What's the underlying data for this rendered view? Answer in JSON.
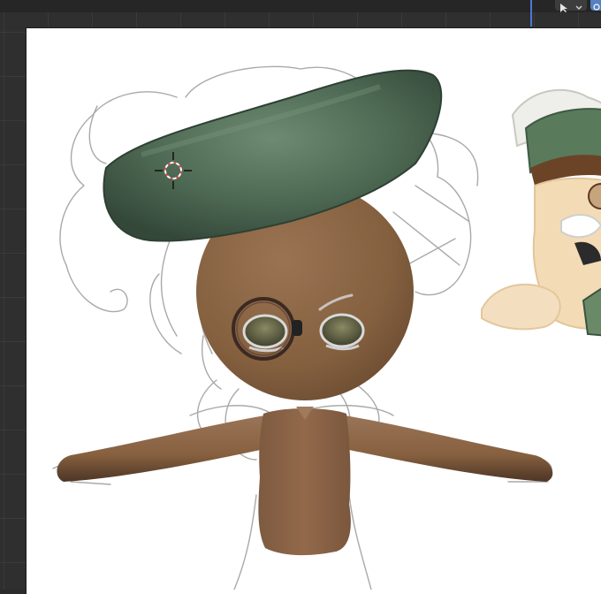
{
  "app": {
    "editor": "3D Viewport"
  },
  "viewport": {
    "background_color": "#2f2f2f",
    "grid_color": "#3a3a3a",
    "reference_image_background": "#ffffff"
  },
  "header": {
    "tool_icon": "select-tool-icon",
    "dropdown_icon": "chevron-down-icon",
    "gizmo_icon": "transform-gizmo-icon",
    "accent_color": "#4d7ad1"
  },
  "scene": {
    "objects": [
      {
        "name": "hat",
        "color": "#4b6650"
      },
      {
        "name": "head",
        "color": "#8a6445"
      },
      {
        "name": "body",
        "color": "#88624a"
      },
      {
        "name": "left-arm",
        "color": "#8b6548"
      },
      {
        "name": "right-arm",
        "color": "#8b6548"
      },
      {
        "name": "monocle",
        "color": "#3b2a22"
      },
      {
        "name": "left-eye",
        "color": "#5a5a3f"
      },
      {
        "name": "right-eye",
        "color": "#5a5a3f"
      }
    ],
    "cursor_icon": "3d-cursor-icon",
    "reference_sketch": "character-reference-sketch",
    "reference_art": "character-reference-artwork"
  }
}
